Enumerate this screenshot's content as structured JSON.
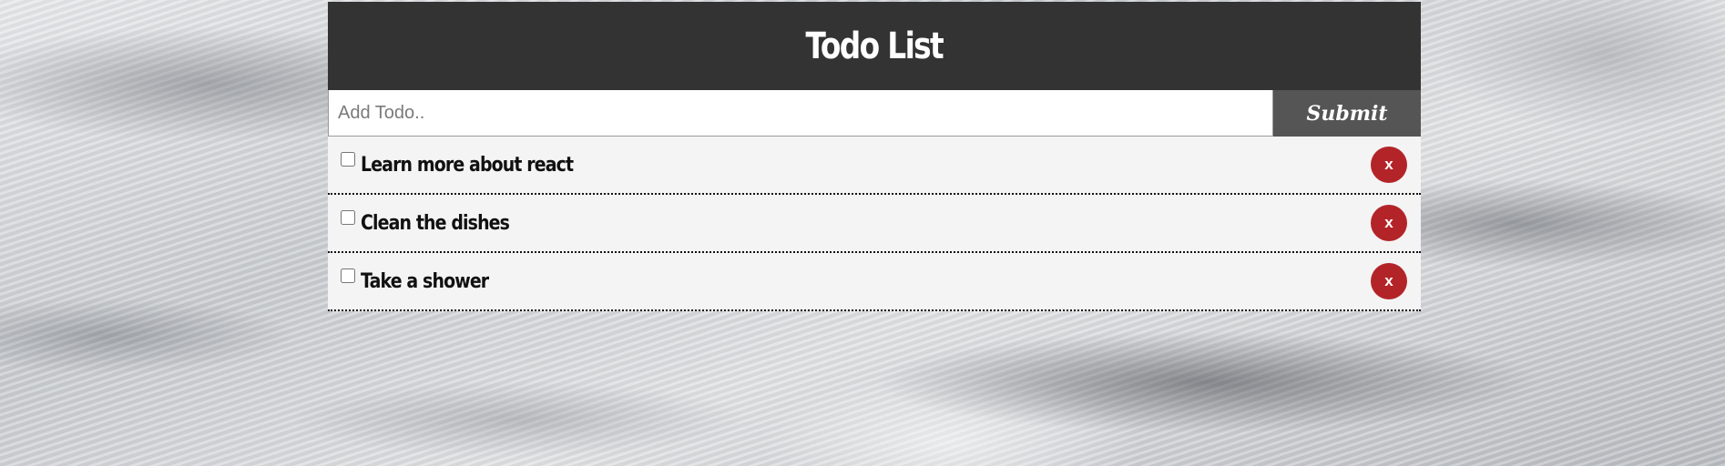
{
  "header": {
    "title": "Todo List"
  },
  "form": {
    "input_placeholder": "Add Todo..",
    "input_value": "",
    "submit_label": "Submit"
  },
  "todos": [
    {
      "label": "Learn more about react",
      "completed": false,
      "delete_label": "x"
    },
    {
      "label": "Clean the dishes",
      "completed": false,
      "delete_label": "x"
    },
    {
      "label": "Take a shower",
      "completed": false,
      "delete_label": "x"
    }
  ],
  "colors": {
    "header_bg": "#333333",
    "submit_bg": "#555555",
    "delete_bg": "#b32428",
    "item_bg": "#f4f4f4"
  }
}
